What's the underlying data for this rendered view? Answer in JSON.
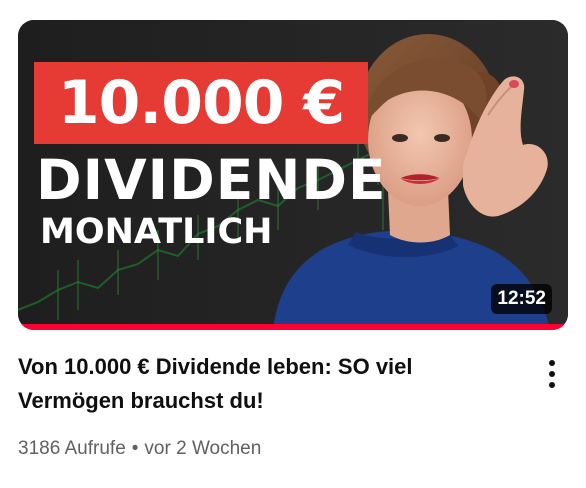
{
  "video": {
    "thumbnail": {
      "headline_amount": "10.000 €",
      "headline_word": "DIVIDENDE",
      "headline_sub": "MONATLICH",
      "accent_color": "#e63a35",
      "duration": "12:52",
      "watched_fraction": 1.0,
      "progress_color": "#ff0033"
    },
    "title": "Von 10.000 € Dividende leben: SO viel Vermögen brauchst du!",
    "views": "3186 Aufrufe",
    "separator": "•",
    "age": "vor 2 Wochen",
    "menu_icon": "more-vertical-icon"
  }
}
